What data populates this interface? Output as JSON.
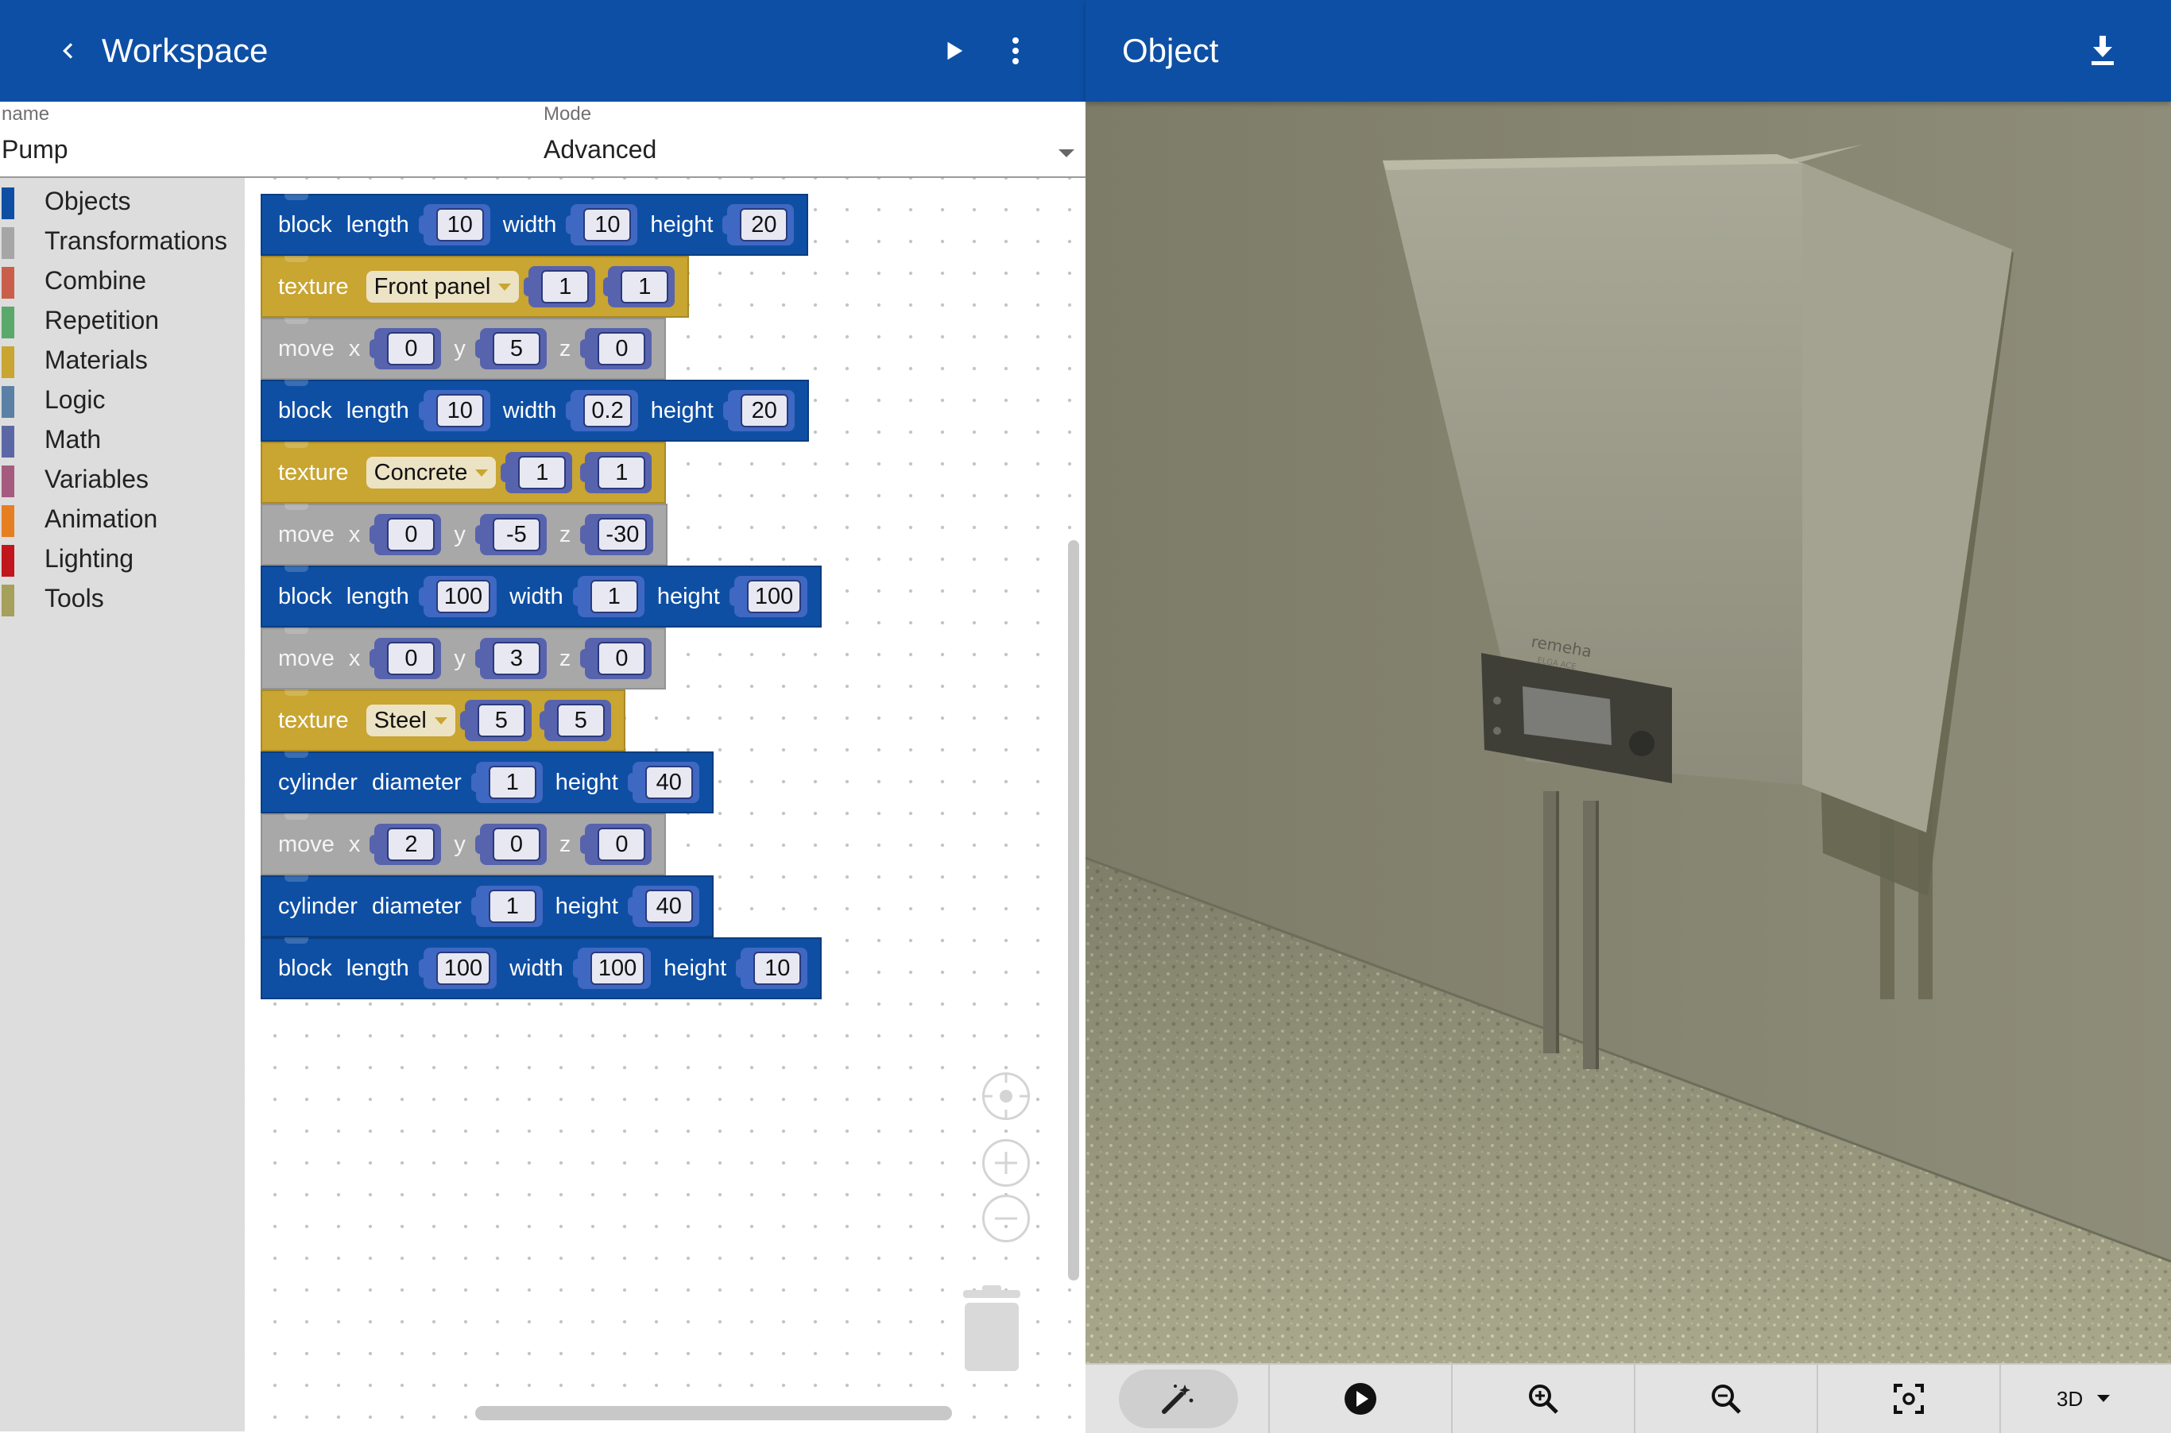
{
  "workspace_bar": {
    "title": "Workspace",
    "back_icon": "chevron-left-icon",
    "run_icon": "play-icon",
    "menu_icon": "more-vert-icon"
  },
  "fields": {
    "name_label": "name",
    "name_value": "Pump",
    "mode_label": "Mode",
    "mode_value": "Advanced"
  },
  "toolbox": [
    {
      "label": "Objects",
      "color": "#0e4fa4"
    },
    {
      "label": "Transformations",
      "color": "#a6a6a6"
    },
    {
      "label": "Combine",
      "color": "#c95f4b"
    },
    {
      "label": "Repetition",
      "color": "#5ba86b"
    },
    {
      "label": "Materials",
      "color": "#c9a531"
    },
    {
      "label": "Logic",
      "color": "#5b80a5"
    },
    {
      "label": "Math",
      "color": "#5b67a5"
    },
    {
      "label": "Variables",
      "color": "#a55b80"
    },
    {
      "label": "Animation",
      "color": "#e67e22"
    },
    {
      "label": "Lighting",
      "color": "#c0161c"
    },
    {
      "label": "Tools",
      "color": "#a5a05b"
    }
  ],
  "blocks": [
    {
      "kind": "blue",
      "keyword": "block",
      "fields": [
        {
          "label": "length",
          "value": "10"
        },
        {
          "label": "width",
          "value": "10"
        },
        {
          "label": "height",
          "value": "20"
        }
      ]
    },
    {
      "kind": "gold",
      "keyword": "texture",
      "dropdown": "Front panel",
      "fields": [
        {
          "label": "",
          "value": "1"
        },
        {
          "label": "",
          "value": "1"
        }
      ]
    },
    {
      "kind": "gray",
      "keyword": "move",
      "fields": [
        {
          "label": "x",
          "value": "0"
        },
        {
          "label": "y",
          "value": "5"
        },
        {
          "label": "z",
          "value": "0"
        }
      ]
    },
    {
      "kind": "blue",
      "keyword": "block",
      "fields": [
        {
          "label": "length",
          "value": "10"
        },
        {
          "label": "width",
          "value": "0.2"
        },
        {
          "label": "height",
          "value": "20"
        }
      ]
    },
    {
      "kind": "gold",
      "keyword": "texture",
      "dropdown": "Concrete",
      "fields": [
        {
          "label": "",
          "value": "1"
        },
        {
          "label": "",
          "value": "1"
        }
      ]
    },
    {
      "kind": "gray",
      "keyword": "move",
      "fields": [
        {
          "label": "x",
          "value": "0"
        },
        {
          "label": "y",
          "value": "-5"
        },
        {
          "label": "z",
          "value": "-30"
        }
      ]
    },
    {
      "kind": "blue",
      "keyword": "block",
      "fields": [
        {
          "label": "length",
          "value": "100"
        },
        {
          "label": "width",
          "value": "1"
        },
        {
          "label": "height",
          "value": "100"
        }
      ]
    },
    {
      "kind": "gray",
      "keyword": "move",
      "fields": [
        {
          "label": "x",
          "value": "0"
        },
        {
          "label": "y",
          "value": "3"
        },
        {
          "label": "z",
          "value": "0"
        }
      ]
    },
    {
      "kind": "gold",
      "keyword": "texture",
      "dropdown": "Steel",
      "fields": [
        {
          "label": "",
          "value": "5"
        },
        {
          "label": "",
          "value": "5"
        }
      ]
    },
    {
      "kind": "blue",
      "keyword": "cylinder",
      "fields": [
        {
          "label": "diameter",
          "value": "1"
        },
        {
          "label": "height",
          "value": "40"
        }
      ]
    },
    {
      "kind": "gray",
      "keyword": "move",
      "fields": [
        {
          "label": "x",
          "value": "2"
        },
        {
          "label": "y",
          "value": "0"
        },
        {
          "label": "z",
          "value": "0"
        }
      ]
    },
    {
      "kind": "blue",
      "keyword": "cylinder",
      "fields": [
        {
          "label": "diameter",
          "value": "1"
        },
        {
          "label": "height",
          "value": "40"
        }
      ]
    },
    {
      "kind": "blue",
      "keyword": "block",
      "fields": [
        {
          "label": "length",
          "value": "100"
        },
        {
          "label": "width",
          "value": "100"
        },
        {
          "label": "height",
          "value": "10"
        }
      ]
    }
  ],
  "object_bar": {
    "title": "Object",
    "download_icon": "download-icon"
  },
  "device_branding": {
    "brand": "remeha",
    "model": "ELGA ACE"
  },
  "bottom_bar": {
    "buttons": [
      "magic-wand-icon",
      "play-circle-icon",
      "zoom-in-icon",
      "zoom-out-icon",
      "focus-frame-icon"
    ],
    "view_mode": "3D"
  }
}
